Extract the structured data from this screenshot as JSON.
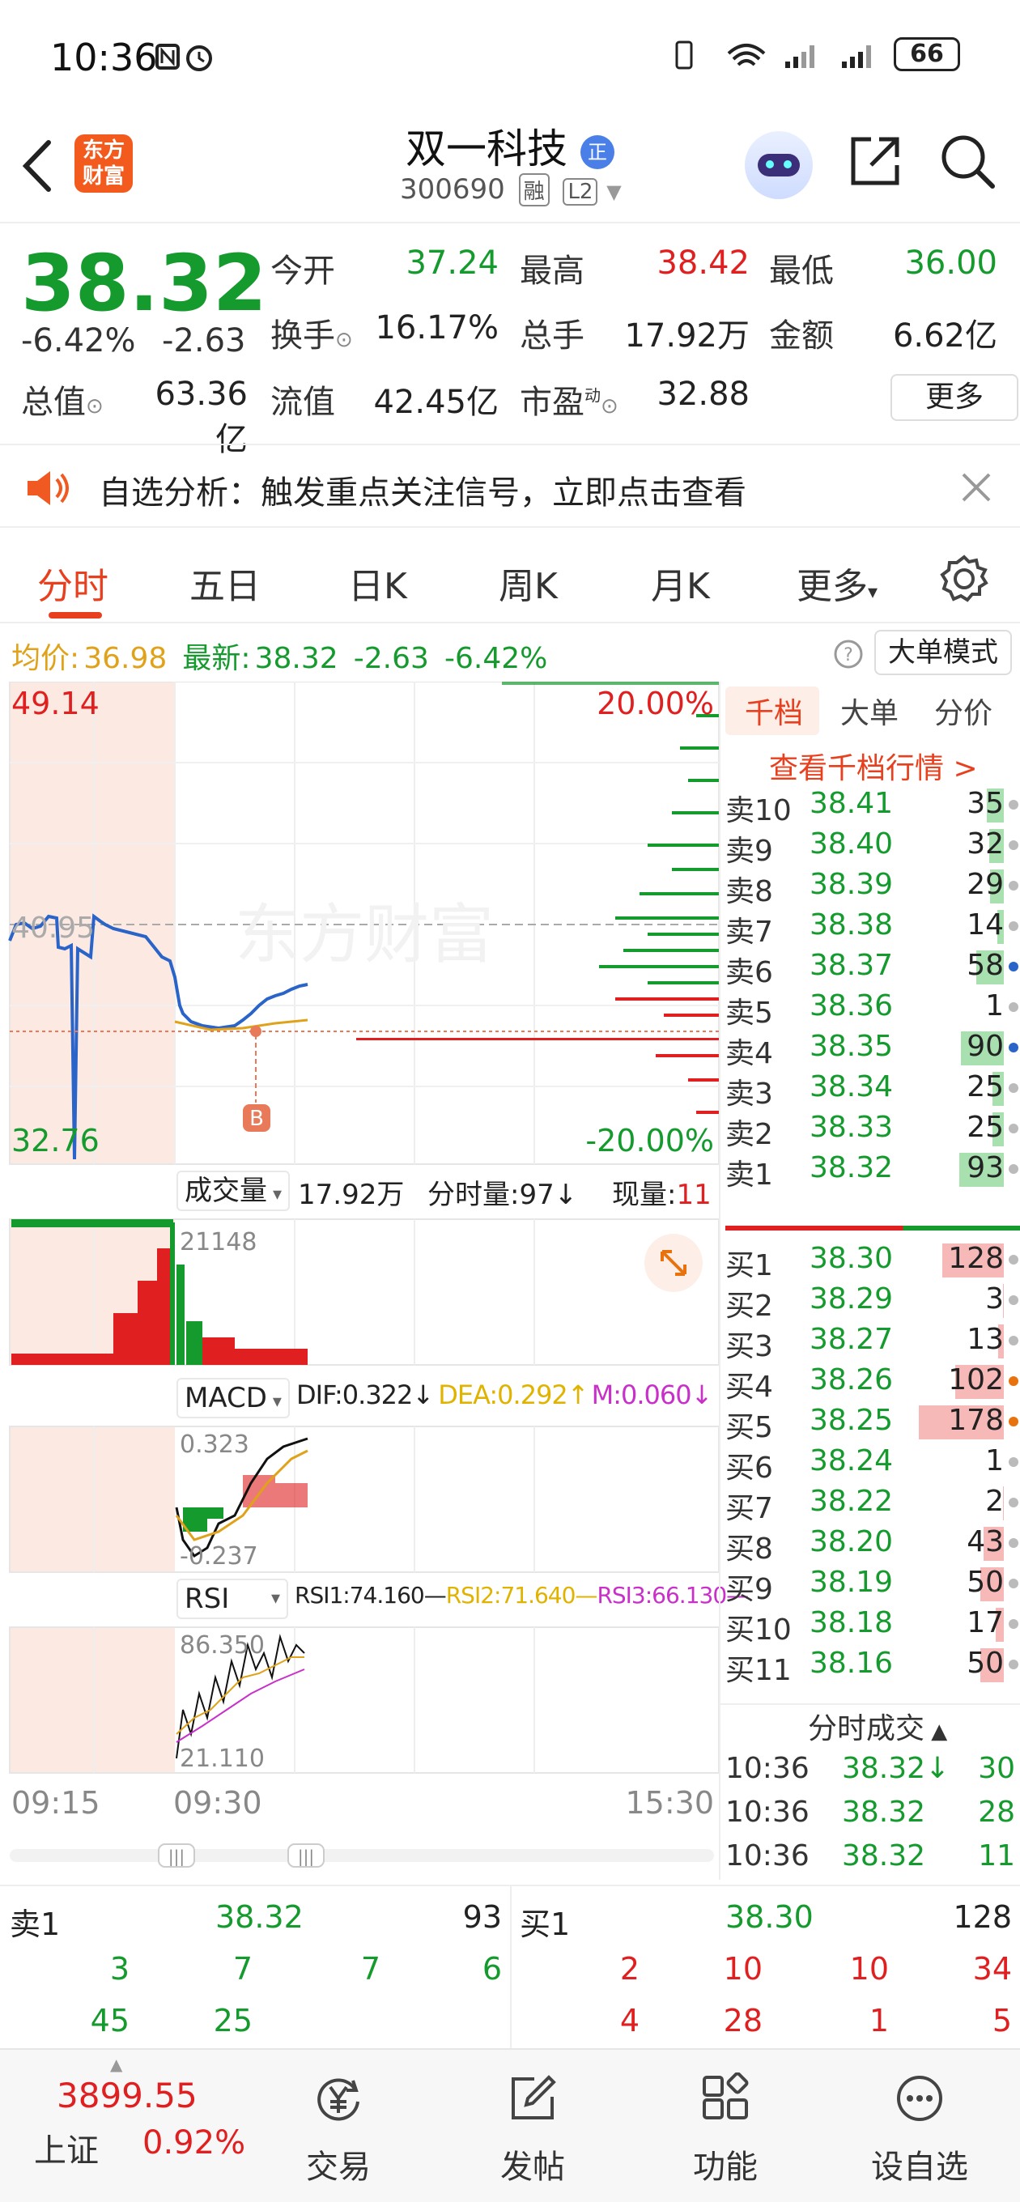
{
  "status_bar": {
    "time": "10:36",
    "battery": "66"
  },
  "header": {
    "logo_text_line1": "东方",
    "logo_text_line2": "财富",
    "stock_name": "双一科技",
    "name_badge": "正",
    "stock_code": "300690",
    "tag_margin": "融",
    "tag_level": "L2"
  },
  "quote": {
    "price": "38.32",
    "change_pct": "-6.42%",
    "change_amt": "-2.63",
    "open_label": "今开",
    "open_value": "37.24",
    "high_label": "最高",
    "high_value": "38.42",
    "low_label": "最低",
    "low_value": "36.00",
    "turnover_label": "换手",
    "turnover_value": "16.17%",
    "volume_label": "总手",
    "volume_value": "17.92万",
    "amount_label": "金额",
    "amount_value": "6.62亿",
    "mktcap_label": "总值",
    "mktcap_value": "63.36亿",
    "float_label": "流值",
    "float_value": "42.45亿",
    "pe_label": "市盈",
    "pe_sup": "动",
    "pe_value": "32.88",
    "more_button": "更多"
  },
  "banner": {
    "text": "自选分析：触发重点关注信号，立即点击查看"
  },
  "tabs": [
    "分时",
    "五日",
    "日K",
    "周K",
    "月K",
    "更多"
  ],
  "info_line": {
    "avg_label": "均价:",
    "avg_value": "36.98",
    "latest_label": "最新:",
    "latest_value": "38.32",
    "latest_change": "-2.63",
    "latest_pct": "-6.42%",
    "big_order_button": "大单模式"
  },
  "intraday_chart": {
    "y_max": "49.14",
    "y_min": "32.76",
    "pct_max": "20.00%",
    "pct_min": "-20.00%",
    "prev_close": "40.95",
    "watermark": "东方财富",
    "marker": "B"
  },
  "volume_panel": {
    "selector": "成交量",
    "total": "17.92万",
    "minute_vol": "分时量:97↓",
    "current_label": "现量:",
    "current_value": "11",
    "max_label": "21148"
  },
  "macd_panel": {
    "selector": "MACD",
    "dif": "DIF:0.322↓",
    "dea": "DEA:0.292↑",
    "m": "M:0.060↓",
    "max_label": "0.323",
    "min_label": "-0.237"
  },
  "rsi_panel": {
    "selector": "RSI",
    "rsi1": "RSI1:74.160—",
    "rsi2": "RSI2:71.640—",
    "rsi3": "RSI3:66.130—",
    "max_label": "86.350",
    "min_label": "21.110"
  },
  "time_axis": {
    "start": "09:15",
    "mid": "09:30",
    "end": "15:30"
  },
  "colors": {
    "up": "#e02020",
    "down": "#159a2e",
    "price_line": "#2a64c8",
    "avg_line": "#e0a21a",
    "accent": "#e8401e"
  },
  "order_book": {
    "tabs": [
      "千档",
      "大单",
      "分价"
    ],
    "link": "查看千档行情 >",
    "asks": [
      {
        "label": "卖10",
        "price": "38.41",
        "vol": "35",
        "dot": "gray",
        "bar": 0.15
      },
      {
        "label": "卖9",
        "price": "38.40",
        "vol": "32",
        "dot": "gray",
        "bar": 0.13
      },
      {
        "label": "卖8",
        "price": "38.39",
        "vol": "29",
        "dot": "gray",
        "bar": 0.12
      },
      {
        "label": "卖7",
        "price": "38.38",
        "vol": "14",
        "dot": "gray",
        "bar": 0.06
      },
      {
        "label": "卖6",
        "price": "38.37",
        "vol": "58",
        "dot": "blue",
        "bar": 0.24
      },
      {
        "label": "卖5",
        "price": "38.36",
        "vol": "1",
        "dot": "gray",
        "bar": 0.0
      },
      {
        "label": "卖4",
        "price": "38.35",
        "vol": "90",
        "dot": "blue",
        "bar": 0.38
      },
      {
        "label": "卖3",
        "price": "38.34",
        "vol": "25",
        "dot": "gray",
        "bar": 0.1
      },
      {
        "label": "卖2",
        "price": "38.33",
        "vol": "25",
        "dot": "gray",
        "bar": 0.1
      },
      {
        "label": "卖1",
        "price": "38.32",
        "vol": "93",
        "dot": "gray",
        "bar": 0.39
      }
    ],
    "bids": [
      {
        "label": "买1",
        "price": "38.30",
        "vol": "128",
        "dot": "gray",
        "bar": 0.54
      },
      {
        "label": "买2",
        "price": "38.29",
        "vol": "3",
        "dot": "gray",
        "bar": 0.01
      },
      {
        "label": "买3",
        "price": "38.27",
        "vol": "13",
        "dot": "gray",
        "bar": 0.05
      },
      {
        "label": "买4",
        "price": "38.26",
        "vol": "102",
        "dot": "orange",
        "bar": 0.43
      },
      {
        "label": "买5",
        "price": "38.25",
        "vol": "178",
        "dot": "orange",
        "bar": 0.75
      },
      {
        "label": "买6",
        "price": "38.24",
        "vol": "1",
        "dot": "gray",
        "bar": 0.0
      },
      {
        "label": "买7",
        "price": "38.22",
        "vol": "2",
        "dot": "gray",
        "bar": 0.01
      },
      {
        "label": "买8",
        "price": "38.20",
        "vol": "43",
        "dot": "gray",
        "bar": 0.18
      },
      {
        "label": "买9",
        "price": "38.19",
        "vol": "50",
        "dot": "gray",
        "bar": 0.21
      },
      {
        "label": "买10",
        "price": "38.18",
        "vol": "17",
        "dot": "gray",
        "bar": 0.07
      },
      {
        "label": "买11",
        "price": "38.16",
        "vol": "50",
        "dot": "gray",
        "bar": 0.21
      }
    ],
    "trades_title": "分时成交",
    "trades": [
      {
        "time": "10:36",
        "price": "38.32↓",
        "vol": "30"
      },
      {
        "time": "10:36",
        "price": "38.32",
        "vol": "28"
      },
      {
        "time": "10:36",
        "price": "38.32",
        "vol": "11"
      }
    ]
  },
  "summary": {
    "ask_label": "卖1",
    "ask_price": "38.32",
    "ask_vol": "93",
    "bid_label": "买1",
    "bid_price": "38.30",
    "bid_vol": "128",
    "ask_queue_row1": [
      "3",
      "7",
      "7",
      "6"
    ],
    "ask_queue_row2": [
      "45",
      "25"
    ],
    "bid_queue_row1": [
      "2",
      "10",
      "10",
      "34"
    ],
    "bid_queue_row2": [
      "4",
      "28",
      "1",
      "5"
    ]
  },
  "bottom_nav": {
    "index_value": "3899.55",
    "index_name": "上证",
    "index_pct": "0.92%",
    "items": [
      {
        "label": "交易",
        "icon": "yen-icon"
      },
      {
        "label": "发帖",
        "icon": "edit-icon"
      },
      {
        "label": "功能",
        "icon": "grid-icon"
      },
      {
        "label": "设自选",
        "icon": "dots-icon"
      }
    ]
  }
}
